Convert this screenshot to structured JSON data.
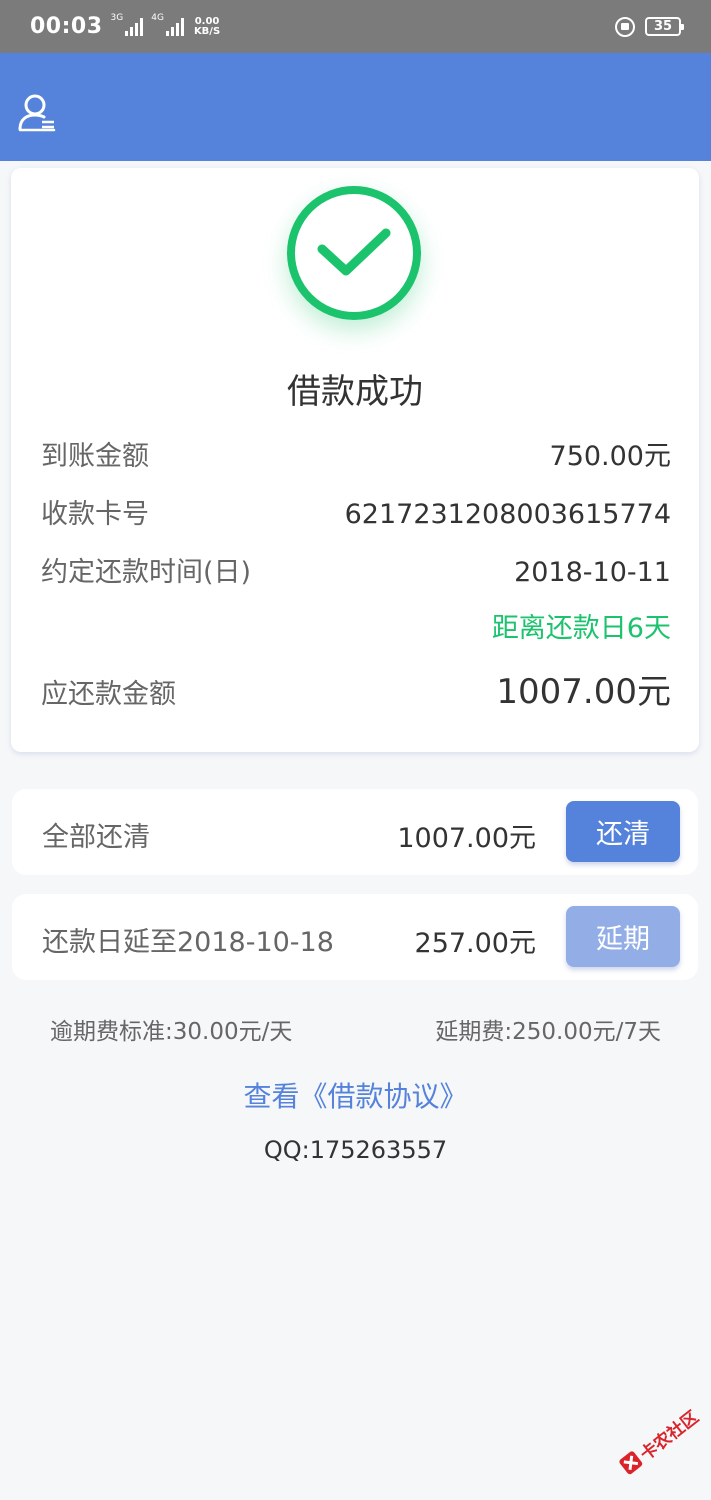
{
  "status_bar": {
    "time": "00:03",
    "net1": "3G",
    "net2": "4G",
    "speed_value": "0.00",
    "speed_unit": "KB/S",
    "battery": "35"
  },
  "header": {
    "icon": "user-menu-icon"
  },
  "result": {
    "icon": "check-circle-icon",
    "title": "借款成功",
    "received_label": "到账金额",
    "received_value": "750.00元",
    "card_label": "收款卡号",
    "card_value": "6217231208003615774",
    "due_label": "约定还款时间(日)",
    "due_value": "2018-10-11",
    "countdown": "距离还款日6天",
    "repay_label": "应还款金额",
    "repay_value": "1007.00元"
  },
  "actions": {
    "payoff_label": "全部还清",
    "payoff_amount": "1007.00元",
    "payoff_button": "还清",
    "extend_label": "还款日延至2018-10-18",
    "extend_amount": "257.00元",
    "extend_button": "延期"
  },
  "fees": {
    "overdue": "逾期费标准:30.00元/天",
    "extension": "延期费:250.00元/7天"
  },
  "agreement_link": "查看《借款协议》",
  "qq": "QQ:175263557",
  "watermark": "卡农社区",
  "colors": {
    "primary": "#5583db",
    "primary_muted": "#93aee7",
    "success": "#1cc36d",
    "watermark": "#d9242b"
  }
}
